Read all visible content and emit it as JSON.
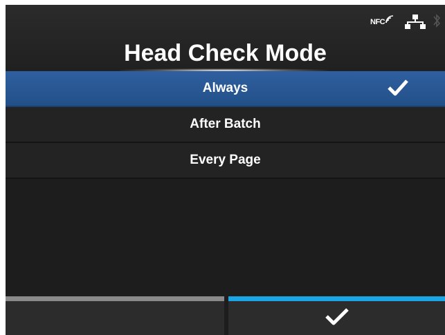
{
  "header": {
    "title": "Head Check Mode",
    "status_icons": {
      "nfc_label": "NFC",
      "network": "network-icon",
      "bluetooth": "bluetooth-icon"
    }
  },
  "options": [
    {
      "label": "Always",
      "selected": true,
      "checked": true
    },
    {
      "label": "After Batch",
      "selected": false,
      "checked": false
    },
    {
      "label": "Every Page",
      "selected": false,
      "checked": false
    }
  ],
  "footer": {
    "left_button": {
      "icon": "",
      "accent_color": "#8a8a8a"
    },
    "right_button": {
      "icon": "check-icon",
      "accent_color": "#1aa6e6"
    }
  },
  "colors": {
    "selected_row": "#2b5a98",
    "background": "#1d1d1d",
    "text": "#ffffff"
  }
}
